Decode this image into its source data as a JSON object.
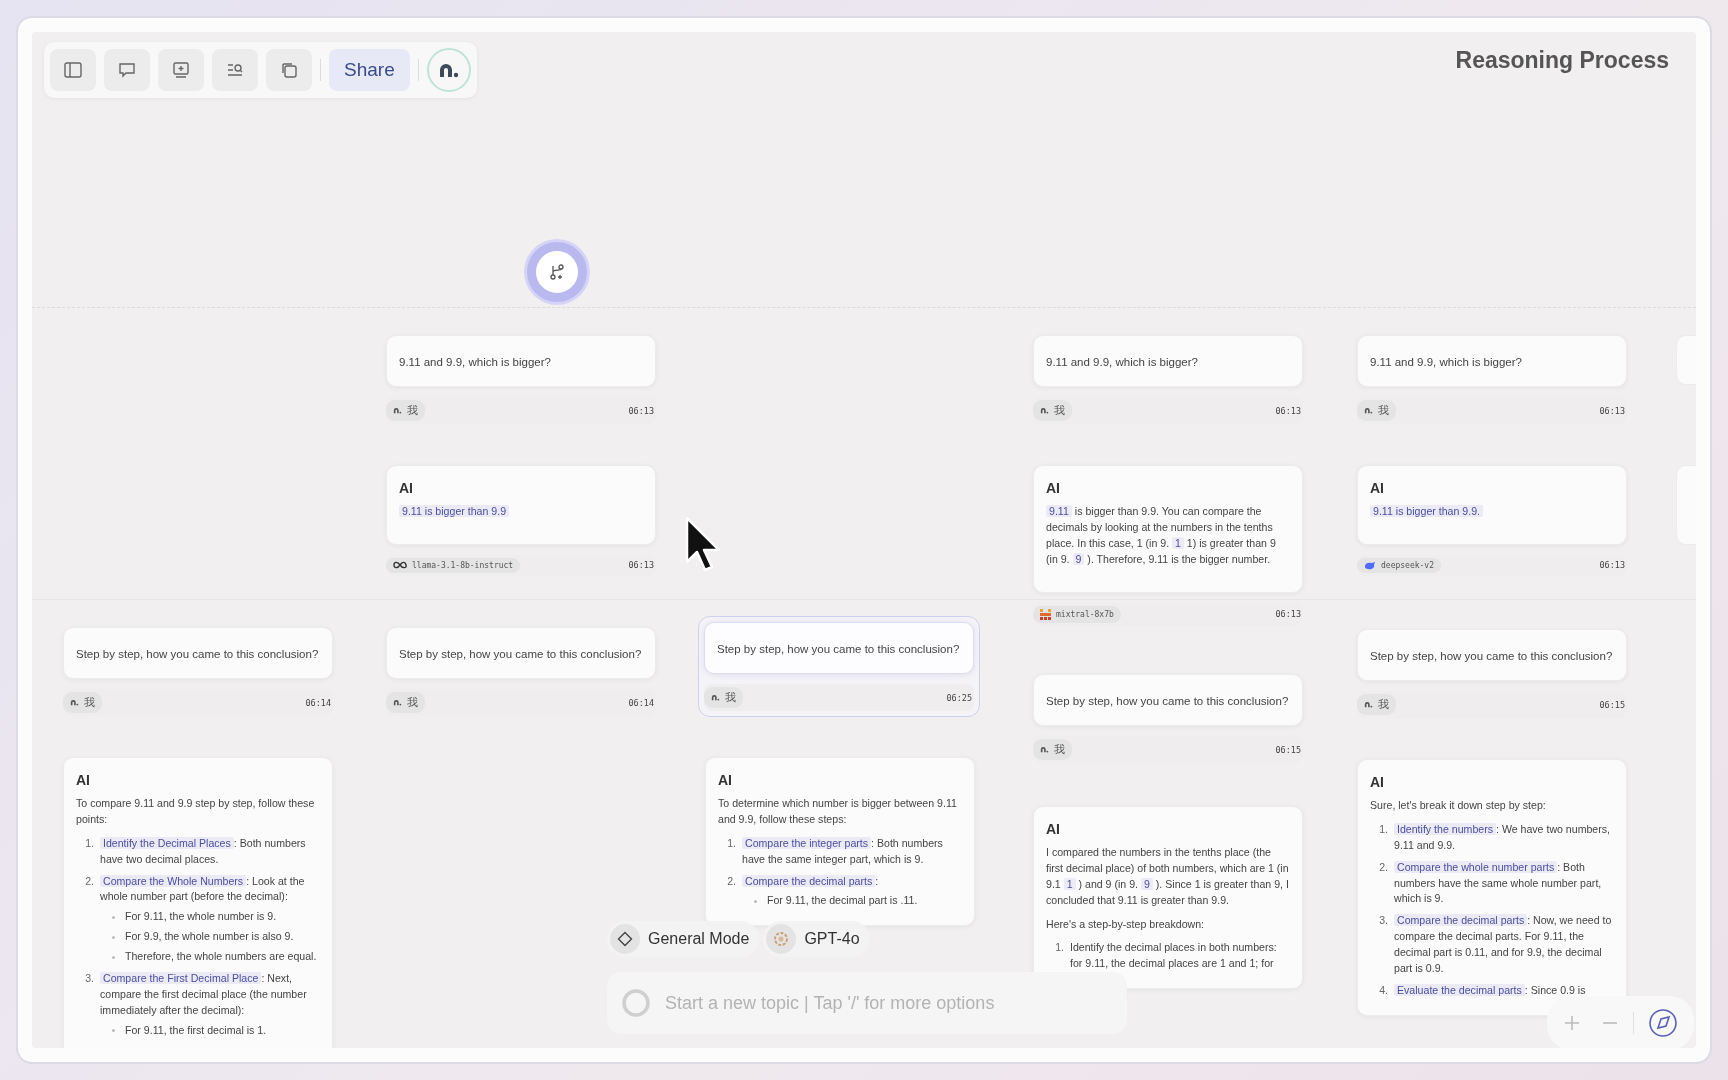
{
  "title": "Reasoning Process",
  "toolbar": {
    "share": "Share"
  },
  "columns": [
    {
      "nodes": [
        {
          "kind": "question",
          "text": "Step by step, how you came to this conclusion?",
          "author": {
            "kind": "user",
            "label": "我"
          },
          "time": "06:14",
          "selected": false
        },
        {
          "kind": "answer",
          "heading": "AI",
          "blocks": [
            {
              "kind": "paragraph",
              "segments": [
                {
                  "text": "To compare 9.11 and 9.9 step by step, follow these points:",
                  "highlighted": false
                }
              ]
            },
            {
              "kind": "list",
              "items": [
                {
                  "number": "1.",
                  "term": "Identify the Decimal Places",
                  "text": ": Both numbers have two decimal places."
                },
                {
                  "number": "2.",
                  "term": "Compare the Whole Numbers",
                  "text": ": Look at the whole number part (before the decimal):",
                  "bullets": [
                    "For 9.11, the whole number is 9.",
                    "For 9.9, the whole number is also 9.",
                    "Therefore, the whole numbers are equal."
                  ]
                },
                {
                  "number": "3.",
                  "term": "Compare the First Decimal Place",
                  "text": ": Next, compare the first decimal place (the number immediately after the decimal):",
                  "bullets": [
                    "For 9.11, the first decimal is 1."
                  ]
                }
              ]
            }
          ]
        }
      ]
    },
    {
      "nodes": [
        {
          "kind": "question",
          "text": "9.11 and 9.9, which is bigger?",
          "author": {
            "kind": "user",
            "label": "我"
          },
          "time": "06:13",
          "selected": false
        },
        {
          "kind": "answer",
          "heading": "AI",
          "blocks": [
            {
              "kind": "paragraph",
              "segments": [
                {
                  "text": "9.11 is bigger than 9.9",
                  "highlighted": true
                }
              ]
            }
          ],
          "author": {
            "kind": "llama",
            "label": "llama-3.1-8b-instruct"
          },
          "time": "06:13"
        },
        {
          "kind": "question",
          "text": "Step by step, how you came to this conclusion?",
          "author": {
            "kind": "user",
            "label": "我"
          },
          "time": "06:14",
          "selected": false
        }
      ]
    },
    {
      "nodes": [
        {
          "kind": "question",
          "text": "Step by step, how you came to this conclusion?",
          "author": {
            "kind": "user",
            "label": "我"
          },
          "time": "06:25",
          "selected": true
        },
        {
          "kind": "answer",
          "heading": "AI",
          "blocks": [
            {
              "kind": "paragraph",
              "segments": [
                {
                  "text": "To determine which number is bigger between 9.11 and 9.9, follow these steps:",
                  "highlighted": false
                }
              ]
            },
            {
              "kind": "list",
              "items": [
                {
                  "number": "1.",
                  "term": "Compare the integer parts",
                  "text": ": Both numbers have the same integer part, which is 9."
                },
                {
                  "number": "2.",
                  "term": "Compare the decimal parts",
                  "text": ":",
                  "bullets": [
                    "For 9.11, the decimal part is .11."
                  ]
                }
              ]
            }
          ]
        }
      ]
    },
    {
      "nodes": [
        {
          "kind": "question",
          "text": "9.11 and 9.9, which is bigger?",
          "author": {
            "kind": "user",
            "label": "我"
          },
          "time": "06:13",
          "selected": false
        },
        {
          "kind": "answer",
          "heading": "AI",
          "blocks": [
            {
              "kind": "paragraph",
              "segments": [
                {
                  "text": "9.11",
                  "highlighted": true
                },
                {
                  "text": " is bigger than 9.9. You can compare the decimals by looking at the numbers in the tenths place. In this case, 1 (in 9. ",
                  "highlighted": false
                },
                {
                  "text": "1",
                  "highlighted": true
                },
                {
                  "text": " 1) is greater than 9 (in 9. ",
                  "highlighted": false
                },
                {
                  "text": "9",
                  "highlighted": true
                },
                {
                  "text": " ). Therefore, 9.11 is the bigger number.",
                  "highlighted": false
                }
              ]
            }
          ],
          "author": {
            "kind": "mixtral",
            "label": "mixtral-8x7b"
          },
          "time": "06:13"
        },
        {
          "kind": "question",
          "text": "Step by step, how you came to this conclusion?",
          "author": {
            "kind": "user",
            "label": "我"
          },
          "time": "06:15",
          "selected": false
        },
        {
          "kind": "answer",
          "heading": "AI",
          "blocks": [
            {
              "kind": "paragraph",
              "segments": [
                {
                  "text": "I compared the numbers in the tenths place (the first decimal place) of both numbers, which are 1 (in 9.1 ",
                  "highlighted": false
                },
                {
                  "text": "1",
                  "highlighted": true
                },
                {
                  "text": " ) and 9 (in 9. ",
                  "highlighted": false
                },
                {
                  "text": "9",
                  "highlighted": true
                },
                {
                  "text": " ). Since 1 is greater than 9, I concluded that 9.11 is greater than 9.9.",
                  "highlighted": false
                }
              ]
            },
            {
              "kind": "paragraph",
              "segments": [
                {
                  "text": "Here's a step-by-step breakdown:",
                  "highlighted": false
                }
              ]
            },
            {
              "kind": "list",
              "items": [
                {
                  "number": "1.",
                  "text": "Identify the decimal places in both numbers: for 9.11, the decimal places are 1 and 1; for"
                }
              ]
            }
          ]
        }
      ]
    },
    {
      "nodes": [
        {
          "kind": "question",
          "text": "9.11 and 9.9, which is bigger?",
          "author": {
            "kind": "user",
            "label": "我"
          },
          "time": "06:13",
          "selected": false
        },
        {
          "kind": "answer",
          "heading": "AI",
          "blocks": [
            {
              "kind": "paragraph",
              "segments": [
                {
                  "text": "9.11 is bigger than 9.9.",
                  "highlighted": true
                }
              ]
            }
          ],
          "author": {
            "kind": "deepseek",
            "label": "deepseek-v2"
          },
          "time": "06:13"
        },
        {
          "kind": "question",
          "text": "Step by step, how you came to this conclusion?",
          "author": {
            "kind": "user",
            "label": "我"
          },
          "time": "06:15",
          "selected": false
        },
        {
          "kind": "answer",
          "heading": "AI",
          "blocks": [
            {
              "kind": "paragraph",
              "segments": [
                {
                  "text": "Sure, let's break it down step by step:",
                  "highlighted": false
                }
              ]
            },
            {
              "kind": "list",
              "items": [
                {
                  "number": "1.",
                  "term": "Identify the numbers",
                  "text": ": We have two numbers, 9.11 and 9.9."
                },
                {
                  "number": "2.",
                  "term": "Compare the whole number parts",
                  "text": ": Both numbers have the same whole number part, which is 9."
                },
                {
                  "number": "3.",
                  "term": "Compare the decimal parts",
                  "text": ": Now, we need to compare the decimal parts. For 9.11, the decimal part is 0.11, and for 9.9, the decimal part is 0.9."
                },
                {
                  "number": "4.",
                  "term": "Evaluate the decimal parts",
                  "text": ": Since 0.9 is"
                }
              ]
            }
          ]
        }
      ]
    }
  ],
  "mode_chips": [
    {
      "kind": "mode",
      "label": "General Mode"
    },
    {
      "kind": "model",
      "label": "GPT-4o"
    }
  ],
  "composer": {
    "placeholder": "Start a new topic | Tap '/' for more options"
  }
}
